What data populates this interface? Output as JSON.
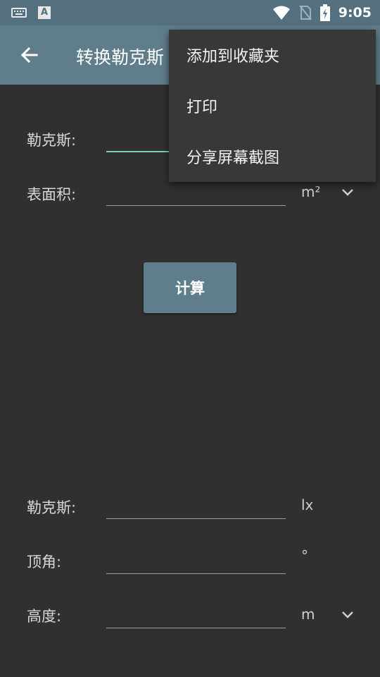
{
  "status_bar": {
    "time": "9:05",
    "icons": [
      "keyboard-icon",
      "a-notification-icon",
      "wifi-icon",
      "no-sim-icon",
      "battery-charging-icon"
    ]
  },
  "app_bar": {
    "title": "转换勒克斯",
    "back_icon": "arrow-back-icon"
  },
  "inputs": [
    {
      "label": "勒克斯:",
      "value": "",
      "unit": ""
    },
    {
      "label": "表面积:",
      "value": "",
      "unit": "m²",
      "dropdown": true
    }
  ],
  "calculate_button": "计算",
  "results": [
    {
      "label": "勒克斯:",
      "value": "",
      "unit": "lx"
    },
    {
      "label": "顶角:",
      "value": "",
      "unit": "°"
    },
    {
      "label": "高度:",
      "value": "",
      "unit": "m",
      "dropdown": true
    }
  ],
  "overflow_menu": {
    "items": [
      "添加到收藏夹",
      "打印",
      "分享屏幕截图"
    ]
  },
  "colors": {
    "status_bar": "#54707e",
    "app_bar": "#607d8b",
    "background": "#303030",
    "focus_accent": "#80cbc4",
    "menu": "#383838"
  }
}
